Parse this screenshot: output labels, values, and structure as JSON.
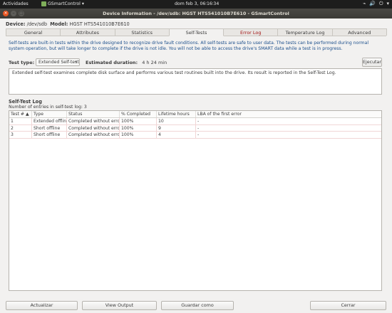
{
  "topbar": {
    "activities": "Actividades",
    "app_name": "GSmartControl",
    "app_arrow": "▾",
    "clock": "dom feb  3, 06∶16∶34",
    "tray": [
      "⌁",
      "🔊",
      "⏻",
      "▾"
    ]
  },
  "window": {
    "title": "Device Information - /dev/sdb: HGST HTS541010B7E610 - GSmartControl",
    "close_glyph": "×",
    "minimize_glyph": "–",
    "maximize_glyph": "□"
  },
  "device": {
    "device_label": "Device:",
    "device_value": "/dev/sdb",
    "model_label": "Model:",
    "model_value": "HGST HTS541010B7E610"
  },
  "tabs": [
    "General",
    "Attributes",
    "Statistics",
    "Self-Tests",
    "Error Log",
    "Temperature Log",
    "Advanced"
  ],
  "selftests": {
    "intro": "Self-tests are built-in tests within the drive designed to recognize drive fault conditions. All self-tests are safe to user data. The tests can be performed during normal system operation, but will take longer to complete if the drive is not idle. You will not be able to access the drive's SMART data while a test is in progress.",
    "test_type_label": "Test type:",
    "test_type_value": "Extended Self-test",
    "combo_arrow": "▾",
    "estimated_label": "Estimated duration:",
    "estimated_value": "4 h 24 min",
    "execute_label": "Ejecutar",
    "description": "Extended self-test examines complete disk surface and performs various test routines built into the drive. Its result is reported in the Self-Test Log.",
    "log_title": "Self-Test Log",
    "log_count": "Number of entries in self-test log: 3",
    "columns": [
      "Test # ▲",
      "Type",
      "Status",
      "% Completed",
      "Lifetime hours",
      "LBA of the first error"
    ],
    "rows": [
      [
        "1",
        "Extended offline",
        "Completed without error",
        "100%",
        "10",
        "-"
      ],
      [
        "2",
        "Short offline",
        "Completed without error",
        "100%",
        "9",
        "-"
      ],
      [
        "3",
        "Short offline",
        "Completed without error",
        "100%",
        "4",
        "-"
      ]
    ]
  },
  "footer": {
    "refresh": "Actualizar",
    "view_output": "View Output",
    "save_as": "Guardar como",
    "close": "Cerrar"
  }
}
